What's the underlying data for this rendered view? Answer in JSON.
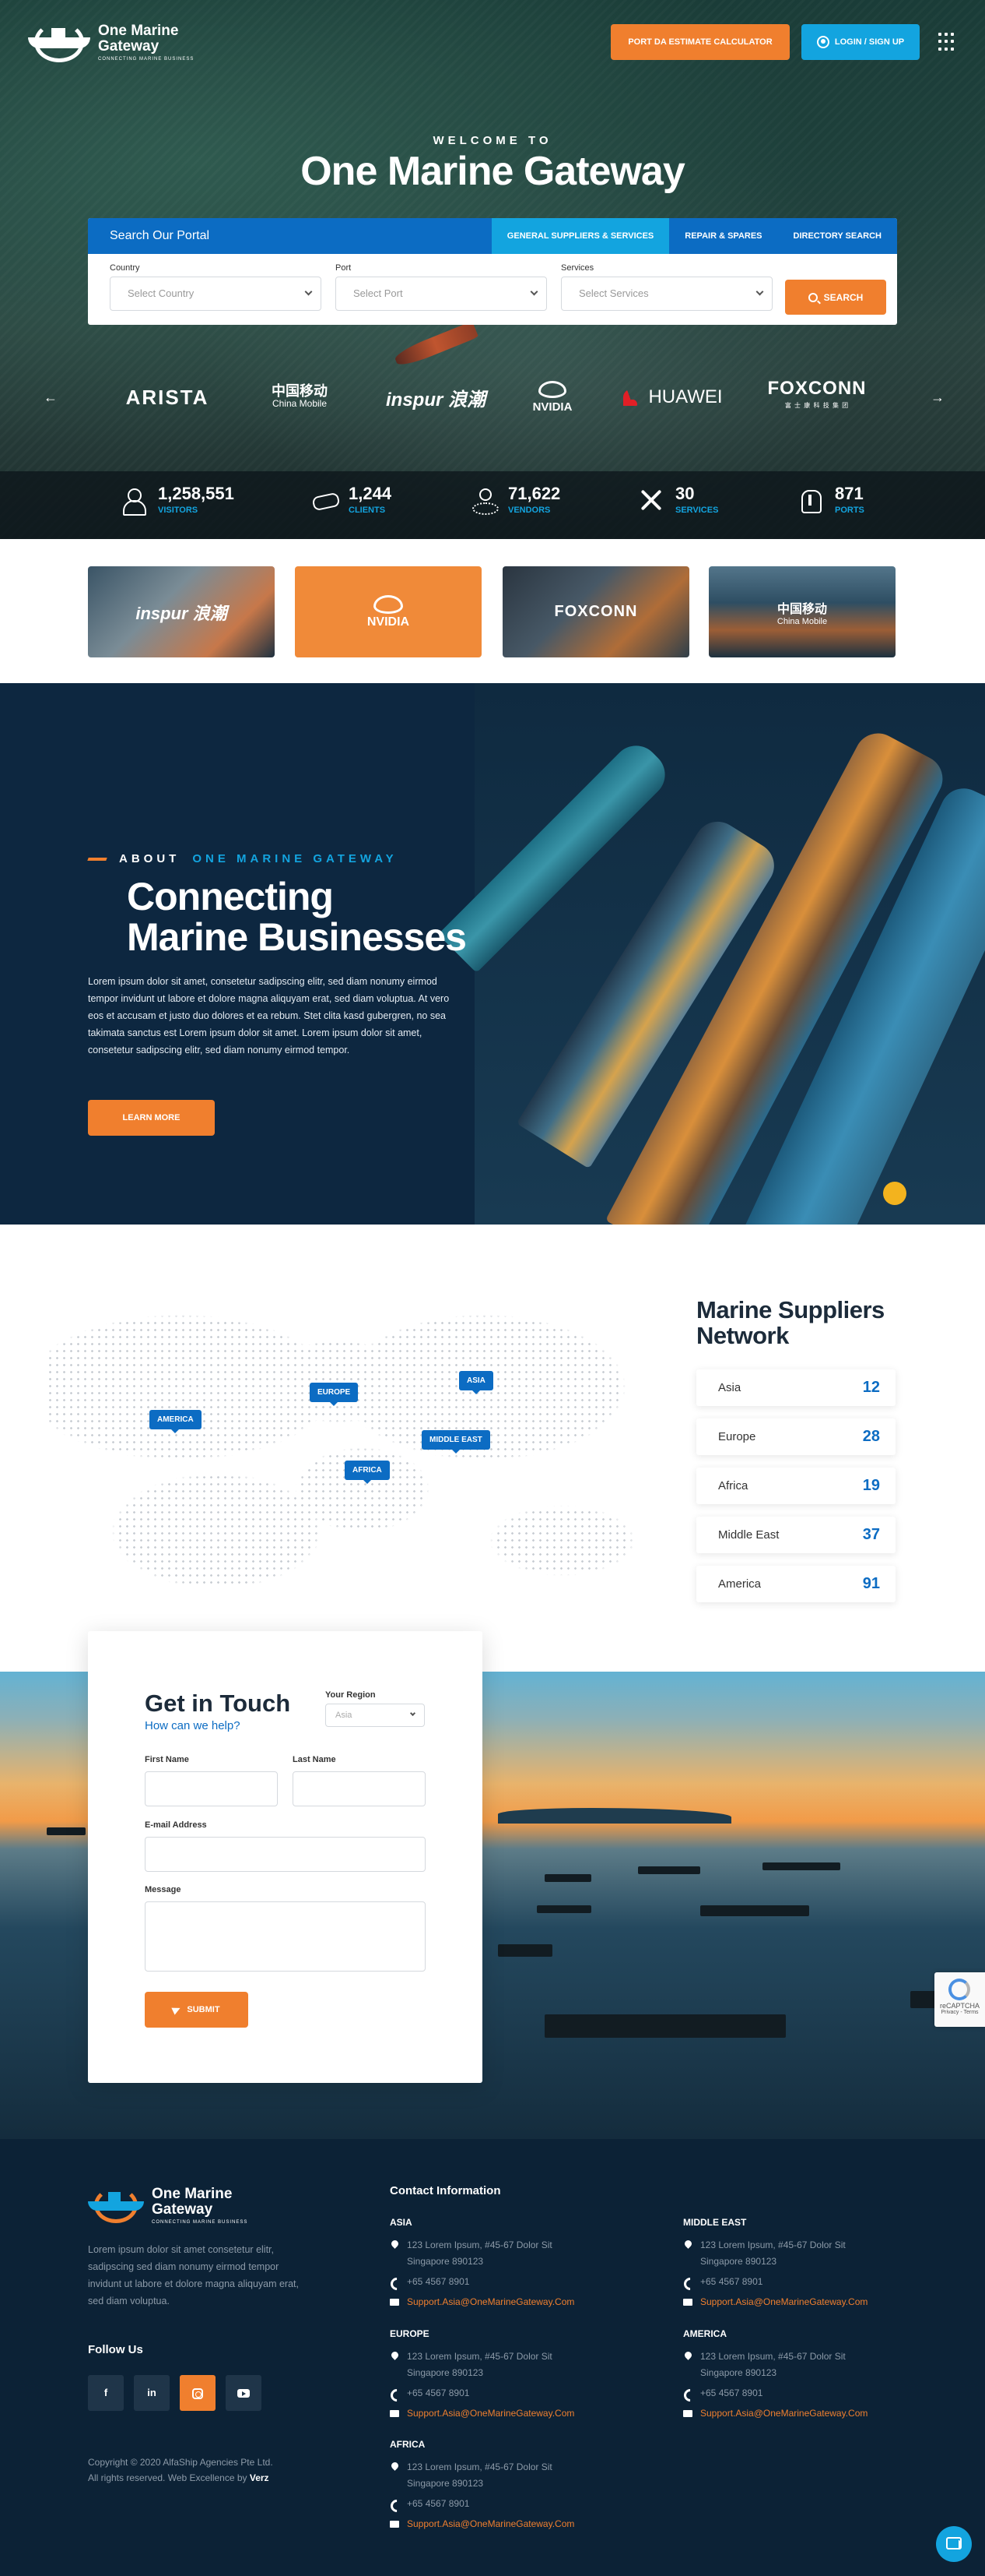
{
  "header": {
    "logo_line1": "One Marine",
    "logo_line2": "Gateway",
    "logo_tagline": "CONNECTING MARINE BUSINESS",
    "estimate_button": "PORT DA ESTIMATE CALCULATOR",
    "login_button": "LOGIN / SIGN UP"
  },
  "hero": {
    "welcome": "WELCOME TO",
    "title": "One Marine Gateway"
  },
  "search": {
    "heading": "Search Our Portal",
    "tabs": [
      {
        "label": "GENERAL SUPPLIERS & SERVICES",
        "active": true
      },
      {
        "label": "REPAIR & SPARES",
        "active": false
      },
      {
        "label": "DIRECTORY SEARCH",
        "active": false
      }
    ],
    "fields": [
      {
        "label": "Country",
        "placeholder": "Select Country"
      },
      {
        "label": "Port",
        "placeholder": "Select Port"
      },
      {
        "label": "Services",
        "placeholder": "Select Services"
      }
    ],
    "button": "SEARCH"
  },
  "brands": {
    "prev": "←",
    "next": "→",
    "items": [
      {
        "name": "ARISTA"
      },
      {
        "name": "中国移动",
        "sub": "China Mobile"
      },
      {
        "name": "inspur 浪潮"
      },
      {
        "name": "NVIDIA"
      },
      {
        "name": "HUAWEI"
      },
      {
        "name": "FOXCONN",
        "sub": "富 士 康 科 技 集 团"
      }
    ]
  },
  "stats": [
    {
      "value": "1,258,551",
      "label": "VISITORS",
      "icon": "visitors-icon"
    },
    {
      "value": "1,244",
      "label": "CLIENTS",
      "icon": "handshake-icon"
    },
    {
      "value": "71,622",
      "label": "VENDORS",
      "icon": "vendors-icon"
    },
    {
      "value": "30",
      "label": "SERVICES",
      "icon": "tools-icon"
    },
    {
      "value": "871",
      "label": "PORTS",
      "icon": "port-icon"
    }
  ],
  "partners": [
    {
      "name": "inspur 浪潮"
    },
    {
      "name": "NVIDIA"
    },
    {
      "name": "FOXCONN"
    },
    {
      "name": "中国移动",
      "sub": "China Mobile"
    }
  ],
  "about": {
    "eyebrow": "ABOUT",
    "eyebrow_highlight": "ONE MARINE GATEWAY",
    "title_line1": "Connecting",
    "title_line2": "Marine Businesses",
    "text": "Lorem ipsum dolor sit amet, consetetur sadipscing elitr, sed diam nonumy eirmod tempor invidunt ut labore et dolore magna aliquyam erat, sed diam voluptua. At vero eos et accusam et justo duo dolores et ea rebum. Stet clita kasd gubergren, no sea takimata sanctus est Lorem ipsum dolor sit amet. Lorem ipsum dolor sit amet, consetetur sadipscing elitr, sed diam nonumy eirmod tempor.",
    "button": "LEARN MORE"
  },
  "network": {
    "title_line1": "Marine Suppliers",
    "title_line2": "Network",
    "map_labels": [
      "AMERICA",
      "EUROPE",
      "ASIA",
      "MIDDLE EAST",
      "AFRICA"
    ],
    "regions": [
      {
        "name": "Asia",
        "count": "12"
      },
      {
        "name": "Europe",
        "count": "28"
      },
      {
        "name": "Africa",
        "count": "19"
      },
      {
        "name": "Middle East",
        "count": "37"
      },
      {
        "name": "America",
        "count": "91"
      }
    ]
  },
  "contact": {
    "title": "Get in Touch",
    "subtitle": "How can we help?",
    "region_label": "Your Region",
    "region_value": "Asia",
    "first_name": "First Name",
    "last_name": "Last Name",
    "email": "E-mail Address",
    "message": "Message",
    "submit": "SUBMIT",
    "recaptcha": "reCAPTCHA",
    "recaptcha_links": "Privacy - Terms"
  },
  "footer": {
    "about": "Lorem ipsum dolor sit amet consetetur elitr, sadipscing sed diam nonumy eirmod tempor invidunt ut labore et dolore magna aliquyam erat, sed diam voluptua.",
    "follow": "Follow Us",
    "social": [
      {
        "label": "f",
        "icon": "facebook-icon"
      },
      {
        "label": "in",
        "icon": "linkedin-icon"
      },
      {
        "label": "",
        "icon": "instagram-icon"
      },
      {
        "label": "",
        "icon": "youtube-icon"
      }
    ],
    "copyright": "Copyright © 2020 AlfaShip Agencies Pte Ltd.",
    "rights_prefix": "All rights reserved. Web Excellence by ",
    "rights_brand": "Verz",
    "contact_title": "Contact Information",
    "offices": [
      {
        "region": "ASIA",
        "address1": "123 Lorem Ipsum, #45-67 Dolor Sit",
        "address2": "Singapore 890123",
        "phone": "+65 4567 8901",
        "email": "Support.Asia@OneMarineGateway.Com"
      },
      {
        "region": "MIDDLE EAST",
        "address1": "123 Lorem Ipsum, #45-67 Dolor Sit",
        "address2": "Singapore 890123",
        "phone": "+65 4567 8901",
        "email": "Support.Asia@OneMarineGateway.Com"
      },
      {
        "region": "EUROPE",
        "address1": "123 Lorem Ipsum, #45-67 Dolor Sit",
        "address2": "Singapore 890123",
        "phone": "+65 4567 8901",
        "email": "Support.Asia@OneMarineGateway.Com"
      },
      {
        "region": "AMERICA",
        "address1": "123 Lorem Ipsum, #45-67 Dolor Sit",
        "address2": "Singapore 890123",
        "phone": "+65 4567 8901",
        "email": "Support.Asia@OneMarineGateway.Com"
      },
      {
        "region": "AFRICA",
        "address1": "123 Lorem Ipsum, #45-67 Dolor Sit",
        "address2": "Singapore 890123",
        "phone": "+65 4567 8901",
        "email": "Support.Asia@OneMarineGateway.Com"
      }
    ]
  },
  "colors": {
    "primary_blue": "#0c6cc3",
    "accent_blue": "#13a4df",
    "accent_orange": "#f07f2e",
    "navy": "#0c2236"
  }
}
